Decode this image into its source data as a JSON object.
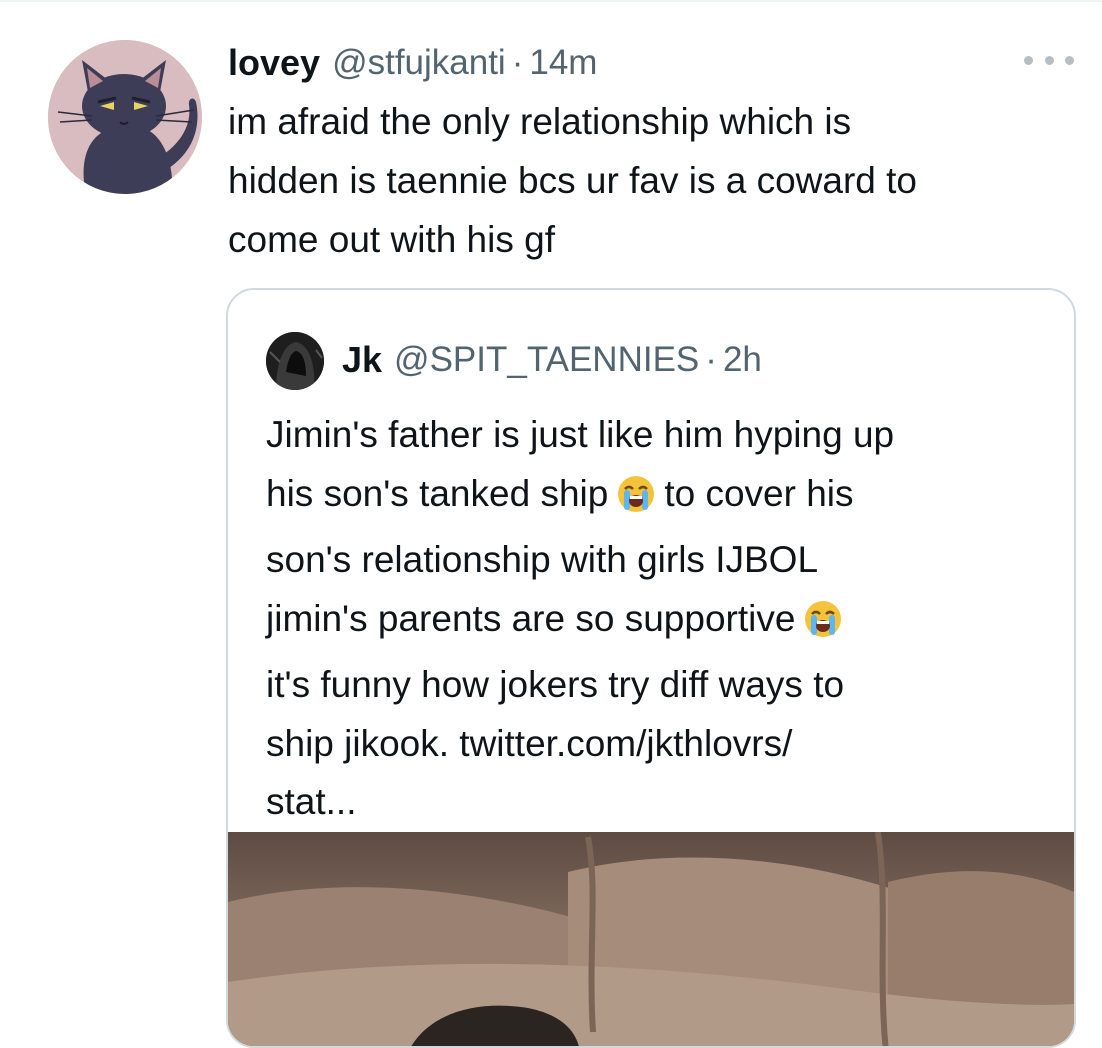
{
  "tweet": {
    "author_name": "lovey",
    "author_handle": "@stfujkanti",
    "separator": "·",
    "time": "14m",
    "avatar_icon": "cat-avatar-icon",
    "more_icon": "more-options-icon",
    "text": "im afraid the only relationship which is\nhidden is taennie bcs ur fav is a coward to\ncome out with his gf"
  },
  "quoted": {
    "author_name": "Jk",
    "author_handle": "@SPIT_TAENNIES",
    "separator": "·",
    "time": "2h",
    "avatar_icon": "hooded-figure-avatar-icon",
    "lines": [
      "Jimin's father is just like him hyping up",
      "his son's tanked ship",
      "to cover his",
      "son's relationship with girls IJBOL",
      "jimin's parents are so supportive",
      "it's funny how jokers try diff ways to",
      "ship jikook. twitter.com/jkthlovrs/",
      "stat..."
    ],
    "emoji_icon": "loudly-crying-face-icon",
    "media_icon": "photo-media-icon"
  },
  "colors": {
    "text": "#0f1419",
    "secondary": "#536471",
    "border": "#cfd9de",
    "divider": "#eff3f4",
    "avatar_bg": "#d9bcbf"
  }
}
